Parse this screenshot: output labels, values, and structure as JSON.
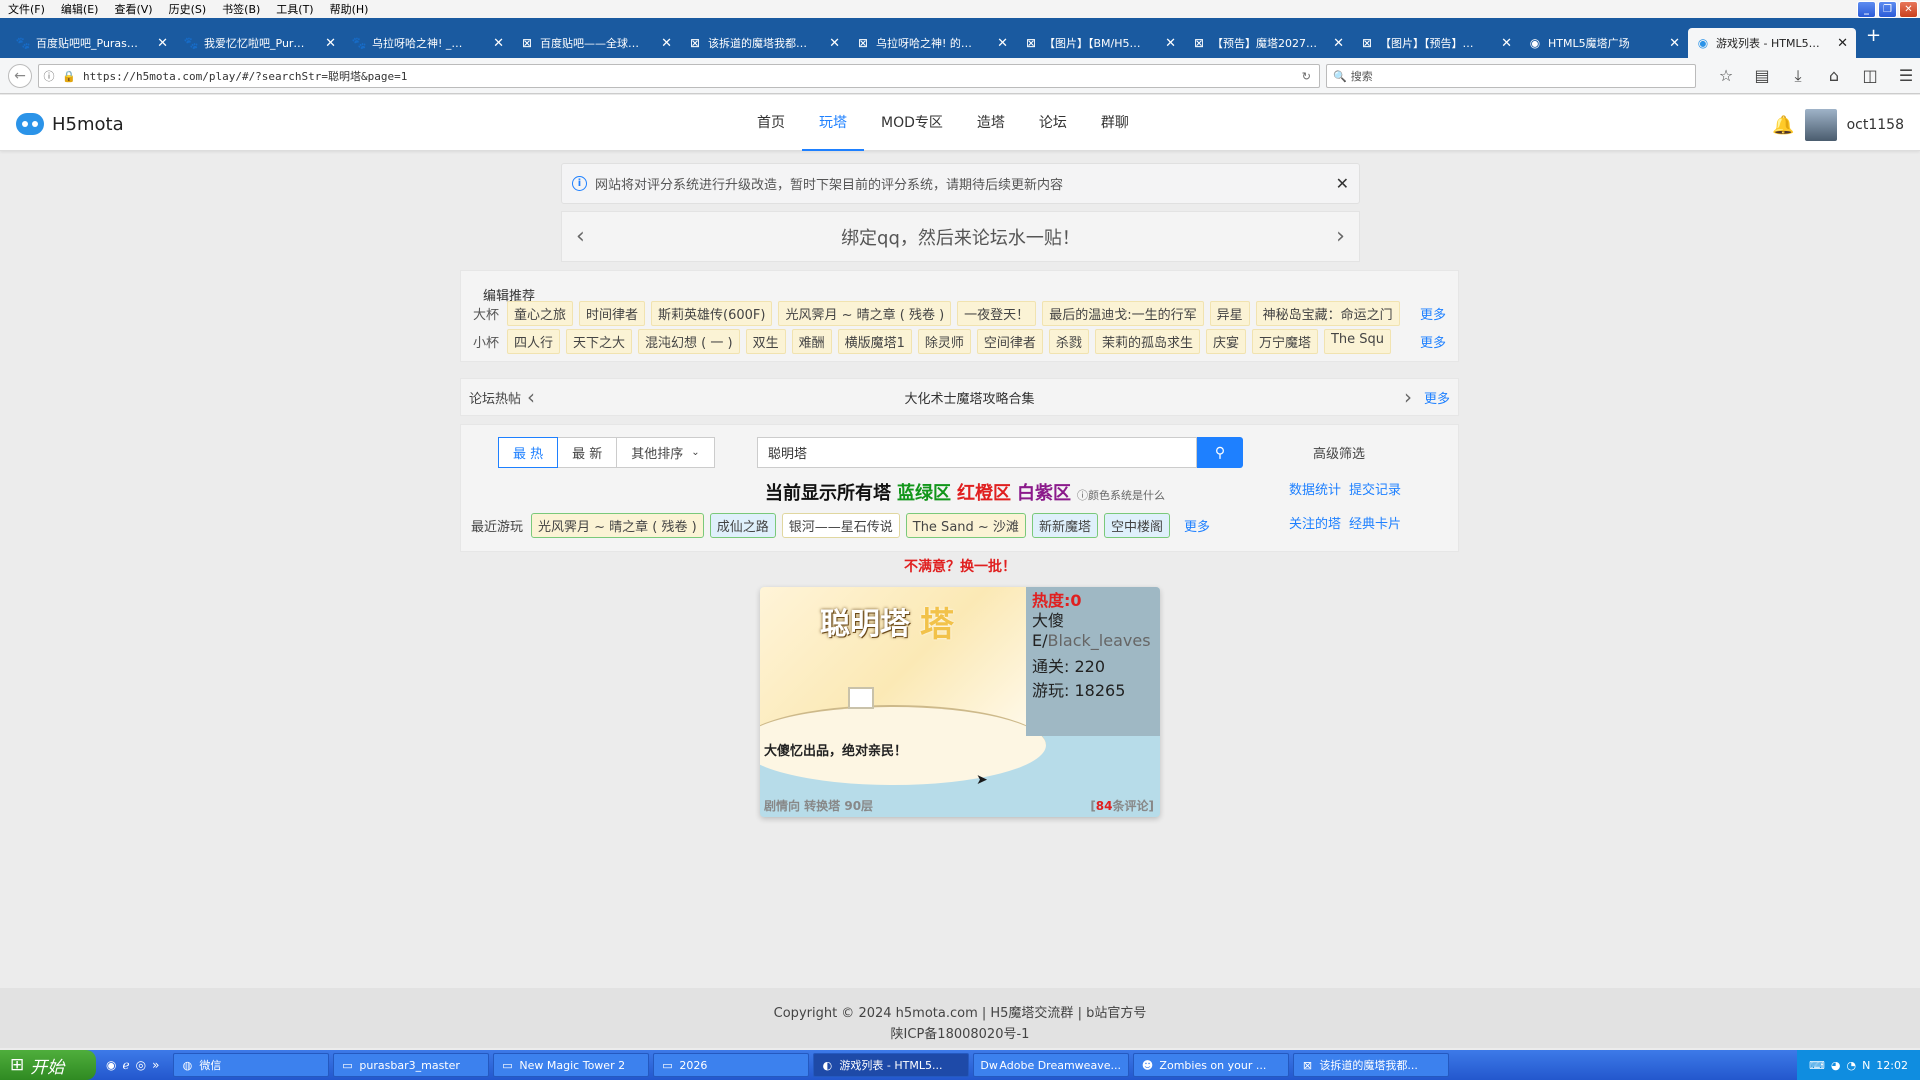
{
  "menubar": {
    "items": [
      "文件(F)",
      "编辑(E)",
      "查看(V)",
      "历史(S)",
      "书签(B)",
      "工具(T)",
      "帮助(H)"
    ]
  },
  "tabs": [
    {
      "label": "百度贴吧吧_Puras…",
      "icon": "paw-icon"
    },
    {
      "label": "我爱忆忆啦吧_Pur…",
      "icon": "paw-icon"
    },
    {
      "label": "乌拉呀哈之神! _…",
      "icon": "paw-icon"
    },
    {
      "label": "百度贴吧——全球…",
      "icon": "tieba-icon"
    },
    {
      "label": "该拆道的魔塔我都…",
      "icon": "tieba-icon"
    },
    {
      "label": "乌拉呀哈之神! 的…",
      "icon": "tieba-icon"
    },
    {
      "label": "【图片】【BM/H5…",
      "icon": "tieba-icon"
    },
    {
      "label": "【预告】魔塔2027…",
      "icon": "tieba-icon"
    },
    {
      "label": "【图片】【预告】…",
      "icon": "tieba-icon"
    },
    {
      "label": "HTML5魔塔广场",
      "icon": "h5-icon"
    },
    {
      "label": "游戏列表 - HTML5…",
      "icon": "h5-icon",
      "active": true
    }
  ],
  "address": {
    "url": "https://h5mota.com/play/#/?searchStr=聪明塔&page=1"
  },
  "browser_search": {
    "placeholder": "搜索"
  },
  "site": {
    "logo_text": "H5mota",
    "nav": [
      "首页",
      "玩塔",
      "MOD专区",
      "造塔",
      "论坛",
      "群聊"
    ],
    "active_nav": "玩塔",
    "username": "oct1158"
  },
  "notice": {
    "text": "网站将对评分系统进行升级改造，暂时下架目前的评分系统，请期待后续更新内容"
  },
  "carousel": {
    "text": "绑定qq，然后来论坛水一贴！"
  },
  "recs": {
    "heading": "编辑推荐",
    "big_label": "大杯",
    "big": [
      "童心之旅",
      "时间律者",
      "斯莉英雄传(600F)",
      "光风霁月 ~ 晴之章 ( 残卷 )",
      "一夜登天！",
      "最后的温迪戈:一生的行军",
      "异星",
      "神秘岛宝藏：命运之门"
    ],
    "small_label": "小杯",
    "small": [
      "四人行",
      "天下之大",
      "混沌幻想 ( 一 )",
      "双生",
      "难酬",
      "横版魔塔1",
      "除灵师",
      "空间律者",
      "杀戮",
      "茉莉的孤岛求生",
      "庆宴",
      "万宁魔塔",
      "The Squ"
    ],
    "more": "更多"
  },
  "forum": {
    "label": "论坛热帖",
    "title": "大化术士魔塔攻略合集",
    "more": "更多"
  },
  "search": {
    "sort": [
      "最 热",
      "最 新",
      "其他排序"
    ],
    "query": "聪明塔",
    "advanced": "高级筛选",
    "show_prefix": "当前显示所有塔",
    "zone_green": "蓝绿区",
    "zone_red": "红橙区",
    "zone_purple": "白紫区",
    "color_q": "颜色系统是什么",
    "stats": "数据统计",
    "submit": "提交记录",
    "recent_label": "最近游玩",
    "recent": [
      "光风霁月 ~ 晴之章 ( 残卷 )",
      "成仙之路",
      "银河——星石传说",
      "The Sand ~ 沙滩",
      "新新魔塔",
      "空中楼阁"
    ],
    "recent_more": "更多",
    "followed": "关注的塔",
    "classic": "经典卡片"
  },
  "refresh": "不满意？换一批！",
  "card": {
    "thumb_title_a": "聪明塔",
    "thumb_title_b": "塔",
    "heat": "热度:0",
    "author_a": "大傻",
    "author_b_prefix": "E/",
    "author_b": "Black_leaves",
    "clears": "通关: 220",
    "plays": "游玩: 18265",
    "desc": "大傻忆出品，绝对亲民！",
    "tags": "剧情向 转换塔 90层",
    "comments_num": "84",
    "comments_suffix": "条评论]",
    "comments_prefix": "["
  },
  "footer": {
    "line1": "Copyright © 2024 h5mota.com   |   H5魔塔交流群   |   b站官方号",
    "line2": "陕ICP备18008020号-1"
  },
  "taskbar": {
    "start": "开始",
    "tasks": [
      "微信",
      "purasbar3_master",
      "New Magic Tower 2",
      "2026",
      "游戏列表 - HTML5...",
      "Adobe Dreamweave...",
      "Zombies on your ...",
      "该拆道的魔塔我都..."
    ],
    "time": "12:02"
  }
}
